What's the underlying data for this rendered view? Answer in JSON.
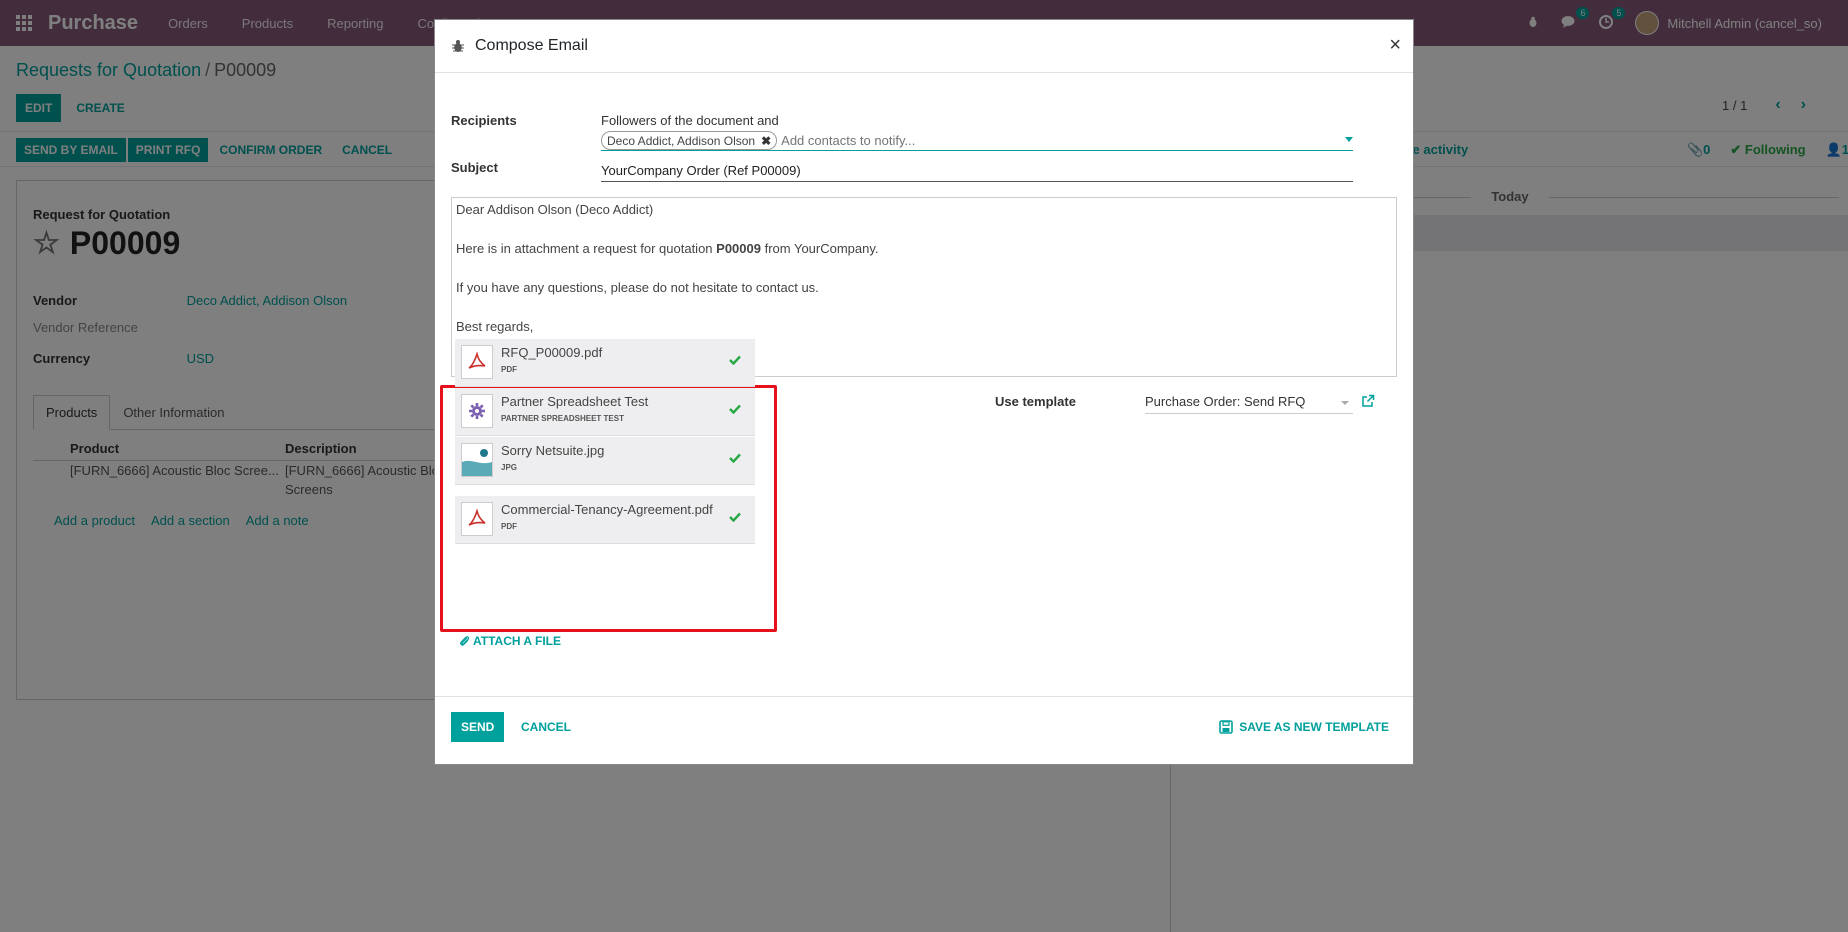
{
  "navbar": {
    "app_name": "Purchase",
    "menu": [
      "Orders",
      "Products",
      "Reporting",
      "Configuration"
    ],
    "messages_count": "6",
    "activities_count": "5",
    "user_name": "Mitchell Admin (cancel_so)"
  },
  "control_panel": {
    "breadcrumb_parent": "Requests for Quotation",
    "breadcrumb_separator": "/",
    "breadcrumb_current": "P00009",
    "edit_label": "EDIT",
    "create_label": "CREATE",
    "pager_value": "1 / 1"
  },
  "statusbar": {
    "send_by_email": "SEND BY EMAIL",
    "print_rfq": "PRINT RFQ",
    "confirm_order": "CONFIRM ORDER",
    "cancel": "CANCEL"
  },
  "form": {
    "doc_type": "Request for Quotation",
    "name": "P00009",
    "vendor_label": "Vendor",
    "vendor_value": "Deco Addict, Addison Olson",
    "vendor_ref_label": "Vendor Reference",
    "currency_label": "Currency",
    "currency_value": "USD",
    "tabs": [
      "Products",
      "Other Information"
    ],
    "columns": [
      "Product",
      "Description"
    ],
    "line_product": "[FURN_6666] Acoustic Bloc Scree...",
    "line_description_1": "[FURN_6666] Acoustic Bloc",
    "line_description_2": "Screens",
    "add_product": "Add a product",
    "add_section": "Add a section",
    "add_note": "Add a note"
  },
  "chatter": {
    "schedule_activity": "ule activity",
    "attachments_count": "0",
    "following": "Following",
    "followers_count": "1",
    "today": "Today"
  },
  "modal": {
    "title": "Compose Email",
    "close": "×",
    "recipients_label": "Recipients",
    "recipients_text": "Followers of the document and",
    "recipient_chip": "Deco Addict, Addison Olson",
    "recipients_placeholder": "Add contacts to notify...",
    "subject_label": "Subject",
    "subject_value": "YourCompany Order (Ref P00009)",
    "body": {
      "greeting": "Dear Addison Olson (Deco Addict)",
      "line2_before": "Here is in attachment a request for quotation ",
      "line2_bold": "P00009",
      "line2_after": " from YourCompany.",
      "line3": "If you have any questions, please do not hesitate to contact us.",
      "closing": "Best regards,"
    },
    "attachments": [
      {
        "name": "RFQ_P00009.pdf",
        "type": "PDF",
        "icon": "pdf-icon"
      },
      {
        "name": "Partner Spreadsheet Test",
        "type": "PARTNER SPREADSHEET TEST",
        "icon": "gear-icon"
      },
      {
        "name": "Sorry Netsuite.jpg",
        "type": "JPG",
        "icon": "image-icon"
      },
      {
        "name": "Commercial-Tenancy-Agreement.pdf",
        "type": "PDF",
        "icon": "pdf-icon"
      }
    ],
    "attach_file": "ATTACH A FILE",
    "use_template_label": "Use template",
    "template_value": "Purchase Order: Send RFQ",
    "send": "SEND",
    "cancel": "CANCEL",
    "save_template": "SAVE AS NEW TEMPLATE"
  },
  "colors": {
    "navbar": "#875a7b",
    "accent": "#00a09d",
    "highlight": "#e5111b",
    "pdf_red": "#c9302c",
    "check_green": "#28a745"
  }
}
